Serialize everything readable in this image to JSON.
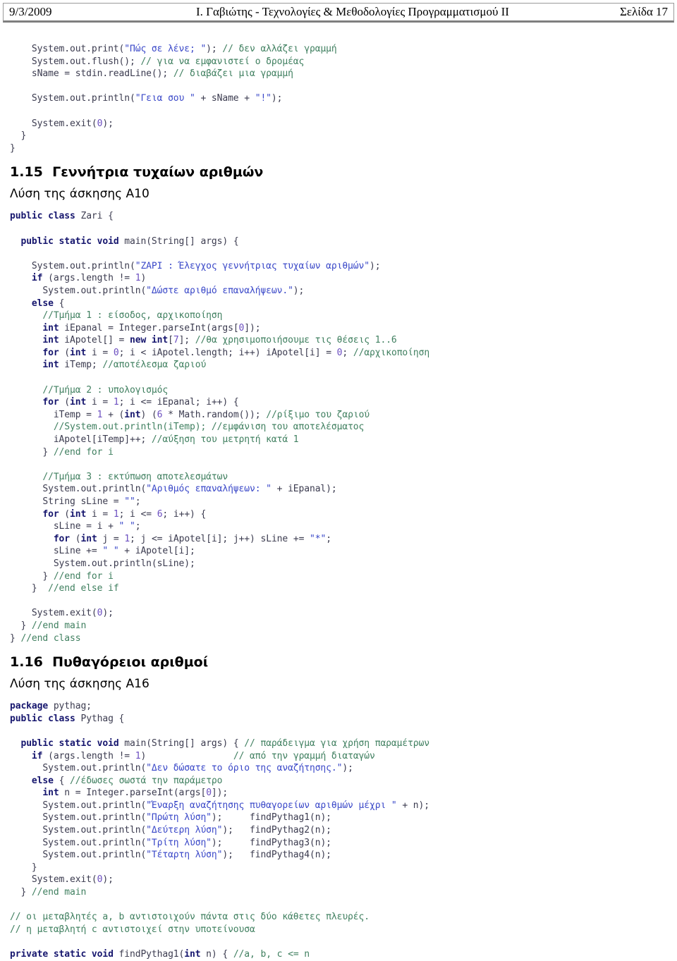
{
  "header": {
    "date": "9/3/2009",
    "title": "Ι. Γαβιώτης - Τεχνολογίες & Μεθοδολογίες Προγραμματισμού ΙΙ",
    "page": "Σελίδα 17"
  },
  "colors": {
    "keyword": "#16166e",
    "string": "#3a48c8",
    "comment": "#3f7f5f",
    "number": "#6b4ec0",
    "plain": "#3b3b4f",
    "rule": "#7f7f7f"
  },
  "blocks": {
    "code_intro": [
      [
        {
          "t": "pln",
          "v": "    System.out.print("
        },
        {
          "t": "str",
          "v": "\"Πώς σε λένε; \""
        },
        {
          "t": "pln",
          "v": "); "
        },
        {
          "t": "cmt",
          "v": "// δεν αλλάζει γραμμή"
        }
      ],
      [
        {
          "t": "pln",
          "v": "    System.out.flush(); "
        },
        {
          "t": "cmt",
          "v": "// για να εμφανιστεί ο δρομέας"
        }
      ],
      [
        {
          "t": "pln",
          "v": "    sName = stdin.readLine(); "
        },
        {
          "t": "cmt",
          "v": "// διαβάζει μια γραμμή"
        }
      ],
      [
        {
          "t": "pln",
          "v": ""
        }
      ],
      [
        {
          "t": "pln",
          "v": "    System.out.println("
        },
        {
          "t": "str",
          "v": "\"Γεια σου \""
        },
        {
          "t": "pln",
          "v": " + sName + "
        },
        {
          "t": "str",
          "v": "\"!\""
        },
        {
          "t": "pln",
          "v": ");"
        }
      ],
      [
        {
          "t": "pln",
          "v": ""
        }
      ],
      [
        {
          "t": "pln",
          "v": "    System.exit("
        },
        {
          "t": "num",
          "v": "0"
        },
        {
          "t": "pln",
          "v": ");"
        }
      ],
      [
        {
          "t": "pln",
          "v": "  }"
        }
      ],
      [
        {
          "t": "pln",
          "v": "}"
        }
      ]
    ],
    "heading_115": "1.15  Γεννήτρια τυχαίων αριθμών",
    "sub_115": "Λύση της άσκησης Α10",
    "code_zari": [
      [
        {
          "t": "kw",
          "v": "public class"
        },
        {
          "t": "pln",
          "v": " Zari {"
        }
      ],
      [
        {
          "t": "pln",
          "v": ""
        }
      ],
      [
        {
          "t": "pln",
          "v": "  "
        },
        {
          "t": "kw",
          "v": "public static void"
        },
        {
          "t": "pln",
          "v": " main(String[] args) {"
        }
      ],
      [
        {
          "t": "pln",
          "v": ""
        }
      ],
      [
        {
          "t": "pln",
          "v": "    System.out.println("
        },
        {
          "t": "str",
          "v": "\"ΖΑΡΙ : Έλεγχος γεννήτριας τυχαίων αριθμών\""
        },
        {
          "t": "pln",
          "v": ");"
        }
      ],
      [
        {
          "t": "pln",
          "v": "    "
        },
        {
          "t": "kw",
          "v": "if"
        },
        {
          "t": "pln",
          "v": " (args.length != "
        },
        {
          "t": "num",
          "v": "1"
        },
        {
          "t": "pln",
          "v": ")"
        }
      ],
      [
        {
          "t": "pln",
          "v": "      System.out.println("
        },
        {
          "t": "str",
          "v": "\"Δώστε αριθμό επαναλήψεων.\""
        },
        {
          "t": "pln",
          "v": ");"
        }
      ],
      [
        {
          "t": "pln",
          "v": "    "
        },
        {
          "t": "kw",
          "v": "else"
        },
        {
          "t": "pln",
          "v": " {"
        }
      ],
      [
        {
          "t": "pln",
          "v": "      "
        },
        {
          "t": "cmt",
          "v": "//Τμήμα 1 : είσοδος, αρχικοποίηση"
        }
      ],
      [
        {
          "t": "pln",
          "v": "      "
        },
        {
          "t": "kw",
          "v": "int"
        },
        {
          "t": "pln",
          "v": " iEpanal = Integer.parseInt(args["
        },
        {
          "t": "num",
          "v": "0"
        },
        {
          "t": "pln",
          "v": "]);"
        }
      ],
      [
        {
          "t": "pln",
          "v": "      "
        },
        {
          "t": "kw",
          "v": "int"
        },
        {
          "t": "pln",
          "v": " iApotel[] = "
        },
        {
          "t": "kw",
          "v": "new int"
        },
        {
          "t": "pln",
          "v": "["
        },
        {
          "t": "num",
          "v": "7"
        },
        {
          "t": "pln",
          "v": "]; "
        },
        {
          "t": "cmt",
          "v": "//θα χρησιμοποιήσουμε τις θέσεις 1..6"
        }
      ],
      [
        {
          "t": "pln",
          "v": "      "
        },
        {
          "t": "kw",
          "v": "for"
        },
        {
          "t": "pln",
          "v": " ("
        },
        {
          "t": "kw",
          "v": "int"
        },
        {
          "t": "pln",
          "v": " i = "
        },
        {
          "t": "num",
          "v": "0"
        },
        {
          "t": "pln",
          "v": "; i < iApotel.length; i++) iApotel[i] = "
        },
        {
          "t": "num",
          "v": "0"
        },
        {
          "t": "pln",
          "v": "; "
        },
        {
          "t": "cmt",
          "v": "//αρχικοποίηση"
        }
      ],
      [
        {
          "t": "pln",
          "v": "      "
        },
        {
          "t": "kw",
          "v": "int"
        },
        {
          "t": "pln",
          "v": " iTemp; "
        },
        {
          "t": "cmt",
          "v": "//αποτέλεσμα ζαριού"
        }
      ],
      [
        {
          "t": "pln",
          "v": ""
        }
      ],
      [
        {
          "t": "pln",
          "v": "      "
        },
        {
          "t": "cmt",
          "v": "//Τμήμα 2 : υπολογισμός"
        }
      ],
      [
        {
          "t": "pln",
          "v": "      "
        },
        {
          "t": "kw",
          "v": "for"
        },
        {
          "t": "pln",
          "v": " ("
        },
        {
          "t": "kw",
          "v": "int"
        },
        {
          "t": "pln",
          "v": " i = "
        },
        {
          "t": "num",
          "v": "1"
        },
        {
          "t": "pln",
          "v": "; i <= iEpanal; i++) {"
        }
      ],
      [
        {
          "t": "pln",
          "v": "        iTemp = "
        },
        {
          "t": "num",
          "v": "1"
        },
        {
          "t": "pln",
          "v": " + ("
        },
        {
          "t": "kw",
          "v": "int"
        },
        {
          "t": "pln",
          "v": ") ("
        },
        {
          "t": "num",
          "v": "6"
        },
        {
          "t": "pln",
          "v": " * Math.random()); "
        },
        {
          "t": "cmt",
          "v": "//ρίξιμο του ζαριού"
        }
      ],
      [
        {
          "t": "pln",
          "v": "        "
        },
        {
          "t": "cmt",
          "v": "//System.out.println(iTemp); //εμφάνιση του αποτελέσματος"
        }
      ],
      [
        {
          "t": "pln",
          "v": "        iApotel[iTemp]++; "
        },
        {
          "t": "cmt",
          "v": "//αύξηση του μετρητή κατά 1"
        }
      ],
      [
        {
          "t": "pln",
          "v": "      } "
        },
        {
          "t": "cmt",
          "v": "//end for i"
        }
      ],
      [
        {
          "t": "pln",
          "v": ""
        }
      ],
      [
        {
          "t": "pln",
          "v": "      "
        },
        {
          "t": "cmt",
          "v": "//Τμήμα 3 : εκτύπωση αποτελεσμάτων"
        }
      ],
      [
        {
          "t": "pln",
          "v": "      System.out.println("
        },
        {
          "t": "str",
          "v": "\"Αριθμός επαναλήψεων: \""
        },
        {
          "t": "pln",
          "v": " + iEpanal);"
        }
      ],
      [
        {
          "t": "pln",
          "v": "      String sLine = "
        },
        {
          "t": "str",
          "v": "\"\""
        },
        {
          "t": "pln",
          "v": ";"
        }
      ],
      [
        {
          "t": "pln",
          "v": "      "
        },
        {
          "t": "kw",
          "v": "for"
        },
        {
          "t": "pln",
          "v": " ("
        },
        {
          "t": "kw",
          "v": "int"
        },
        {
          "t": "pln",
          "v": " i = "
        },
        {
          "t": "num",
          "v": "1"
        },
        {
          "t": "pln",
          "v": "; i <= "
        },
        {
          "t": "num",
          "v": "6"
        },
        {
          "t": "pln",
          "v": "; i++) {"
        }
      ],
      [
        {
          "t": "pln",
          "v": "        sLine = i + "
        },
        {
          "t": "str",
          "v": "\" \""
        },
        {
          "t": "pln",
          "v": ";"
        }
      ],
      [
        {
          "t": "pln",
          "v": "        "
        },
        {
          "t": "kw",
          "v": "for"
        },
        {
          "t": "pln",
          "v": " ("
        },
        {
          "t": "kw",
          "v": "int"
        },
        {
          "t": "pln",
          "v": " j = "
        },
        {
          "t": "num",
          "v": "1"
        },
        {
          "t": "pln",
          "v": "; j <= iApotel[i]; j++) sLine += "
        },
        {
          "t": "str",
          "v": "\"*\""
        },
        {
          "t": "pln",
          "v": ";"
        }
      ],
      [
        {
          "t": "pln",
          "v": "        sLine += "
        },
        {
          "t": "str",
          "v": "\" \""
        },
        {
          "t": "pln",
          "v": " + iApotel[i];"
        }
      ],
      [
        {
          "t": "pln",
          "v": "        System.out.println(sLine);"
        }
      ],
      [
        {
          "t": "pln",
          "v": "      } "
        },
        {
          "t": "cmt",
          "v": "//end for i"
        }
      ],
      [
        {
          "t": "pln",
          "v": "    }  "
        },
        {
          "t": "cmt",
          "v": "//end else if"
        }
      ],
      [
        {
          "t": "pln",
          "v": ""
        }
      ],
      [
        {
          "t": "pln",
          "v": "    System.exit("
        },
        {
          "t": "num",
          "v": "0"
        },
        {
          "t": "pln",
          "v": ");"
        }
      ],
      [
        {
          "t": "pln",
          "v": "  } "
        },
        {
          "t": "cmt",
          "v": "//end main"
        }
      ],
      [
        {
          "t": "pln",
          "v": "} "
        },
        {
          "t": "cmt",
          "v": "//end class"
        }
      ]
    ],
    "heading_116": "1.16  Πυθαγόρειοι αριθμοί",
    "sub_116": "Λύση της άσκησης Α16",
    "code_pythag": [
      [
        {
          "t": "kw",
          "v": "package"
        },
        {
          "t": "pln",
          "v": " pythag;"
        }
      ],
      [
        {
          "t": "kw",
          "v": "public class"
        },
        {
          "t": "pln",
          "v": " Pythag {"
        }
      ],
      [
        {
          "t": "pln",
          "v": ""
        }
      ],
      [
        {
          "t": "pln",
          "v": "  "
        },
        {
          "t": "kw",
          "v": "public static void"
        },
        {
          "t": "pln",
          "v": " main(String[] args) { "
        },
        {
          "t": "cmt",
          "v": "// παράδειγμα για χρήση παραμέτρων"
        }
      ],
      [
        {
          "t": "pln",
          "v": "    "
        },
        {
          "t": "kw",
          "v": "if"
        },
        {
          "t": "pln",
          "v": " (args.length != "
        },
        {
          "t": "num",
          "v": "1"
        },
        {
          "t": "pln",
          "v": ")                "
        },
        {
          "t": "cmt",
          "v": "// από την γραμμή διαταγών"
        }
      ],
      [
        {
          "t": "pln",
          "v": "      System.out.println("
        },
        {
          "t": "str",
          "v": "\"Δεν δώσατε το όριο της αναζήτησης.\""
        },
        {
          "t": "pln",
          "v": ");"
        }
      ],
      [
        {
          "t": "pln",
          "v": "    "
        },
        {
          "t": "kw",
          "v": "else"
        },
        {
          "t": "pln",
          "v": " { "
        },
        {
          "t": "cmt",
          "v": "//έδωσες σωστά την παράμετρο"
        }
      ],
      [
        {
          "t": "pln",
          "v": "      "
        },
        {
          "t": "kw",
          "v": "int"
        },
        {
          "t": "pln",
          "v": " n = Integer.parseInt(args["
        },
        {
          "t": "num",
          "v": "0"
        },
        {
          "t": "pln",
          "v": "]);"
        }
      ],
      [
        {
          "t": "pln",
          "v": "      System.out.println("
        },
        {
          "t": "str",
          "v": "\"Έναρξη αναζήτησης πυθαγορείων αριθμών μέχρι \""
        },
        {
          "t": "pln",
          "v": " + n);"
        }
      ],
      [
        {
          "t": "pln",
          "v": "      System.out.println("
        },
        {
          "t": "str",
          "v": "\"Πρώτη λύση\""
        },
        {
          "t": "pln",
          "v": ");     findPythag1(n);"
        }
      ],
      [
        {
          "t": "pln",
          "v": "      System.out.println("
        },
        {
          "t": "str",
          "v": "\"Δεύτερη λύση\""
        },
        {
          "t": "pln",
          "v": ");   findPythag2(n);"
        }
      ],
      [
        {
          "t": "pln",
          "v": "      System.out.println("
        },
        {
          "t": "str",
          "v": "\"Τρίτη λύση\""
        },
        {
          "t": "pln",
          "v": ");     findPythag3(n);"
        }
      ],
      [
        {
          "t": "pln",
          "v": "      System.out.println("
        },
        {
          "t": "str",
          "v": "\"Τέταρτη λύση\""
        },
        {
          "t": "pln",
          "v": ");   findPythag4(n);"
        }
      ],
      [
        {
          "t": "pln",
          "v": "    }"
        }
      ],
      [
        {
          "t": "pln",
          "v": "    System.exit("
        },
        {
          "t": "num",
          "v": "0"
        },
        {
          "t": "pln",
          "v": ");"
        }
      ],
      [
        {
          "t": "pln",
          "v": "  } "
        },
        {
          "t": "cmt",
          "v": "//end main"
        }
      ],
      [
        {
          "t": "pln",
          "v": ""
        }
      ],
      [
        {
          "t": "cmt",
          "v": "// οι μεταβλητές a, b αντιστοιχούν πάντα στις δύο κάθετες πλευρές."
        }
      ],
      [
        {
          "t": "cmt",
          "v": "// η μεταβλητή c αντιστοιχεί στην υποτείνουσα"
        }
      ],
      [
        {
          "t": "pln",
          "v": ""
        }
      ],
      [
        {
          "t": "kw",
          "v": "private static void"
        },
        {
          "t": "pln",
          "v": " findPythag1("
        },
        {
          "t": "kw",
          "v": "int"
        },
        {
          "t": "pln",
          "v": " n) { "
        },
        {
          "t": "cmt",
          "v": "//a, b, c <= n"
        }
      ]
    ]
  }
}
